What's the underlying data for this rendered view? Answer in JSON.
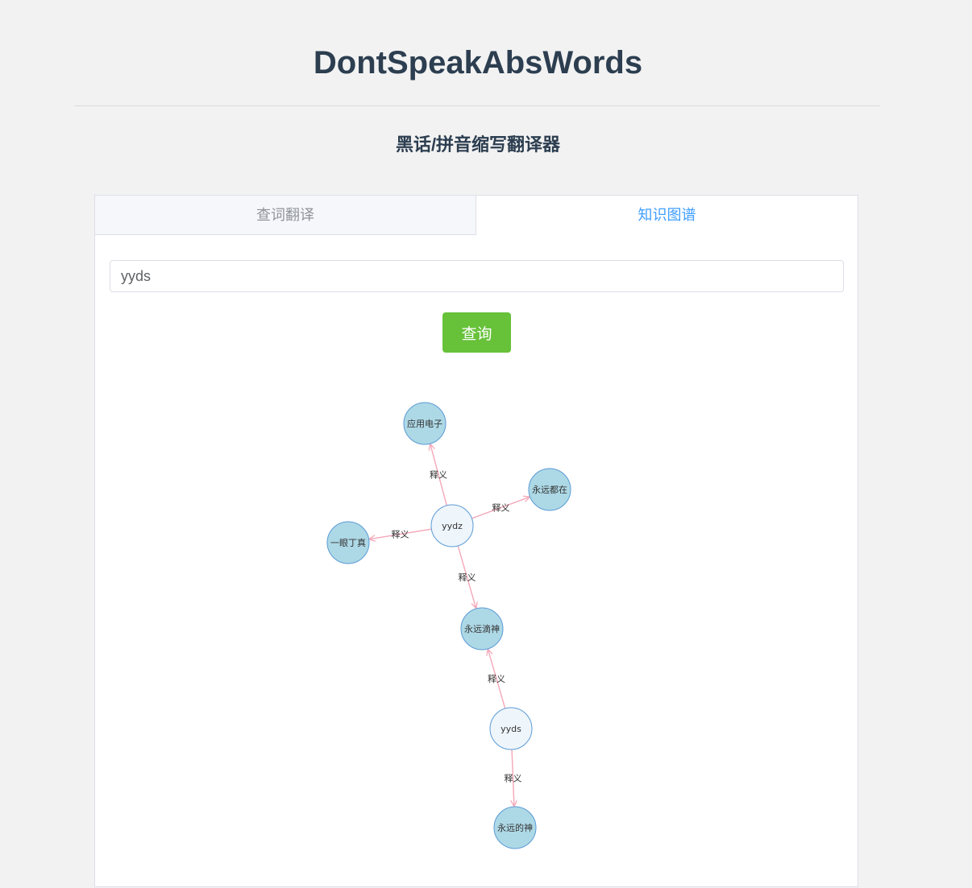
{
  "header": {
    "title": "DontSpeakAbsWords",
    "subtitle": "黑话/拼音缩写翻译器"
  },
  "tabs": [
    {
      "label": "查词翻译",
      "active": false
    },
    {
      "label": "知识图谱",
      "active": true
    }
  ],
  "search": {
    "value": "yyds",
    "button_label": "查询"
  },
  "colors": {
    "accent": "#409eff",
    "button": "#67c23a",
    "node_fill_term": "#eef5fb",
    "node_fill_meaning": "#add8e6",
    "node_stroke": "#5b9bd5",
    "edge": "#f4a7b9"
  },
  "graph": {
    "nodes": [
      {
        "id": "yydz",
        "label": "yydz",
        "kind": "term"
      },
      {
        "id": "yyds",
        "label": "yyds",
        "kind": "term"
      },
      {
        "id": "m1",
        "label": "应用电子",
        "kind": "meaning"
      },
      {
        "id": "m2",
        "label": "永远都在",
        "kind": "meaning"
      },
      {
        "id": "m3",
        "label": "一眼丁真",
        "kind": "meaning"
      },
      {
        "id": "m4",
        "label": "永远滴神",
        "kind": "meaning"
      },
      {
        "id": "m5",
        "label": "永远的神",
        "kind": "meaning"
      }
    ],
    "edges": [
      {
        "source": "yydz",
        "target": "m1",
        "label": "释义"
      },
      {
        "source": "yydz",
        "target": "m2",
        "label": "释义"
      },
      {
        "source": "yydz",
        "target": "m3",
        "label": "释义"
      },
      {
        "source": "yydz",
        "target": "m4",
        "label": "释义"
      },
      {
        "source": "yyds",
        "target": "m4",
        "label": "释义"
      },
      {
        "source": "yyds",
        "target": "m5",
        "label": "释义"
      }
    ]
  }
}
